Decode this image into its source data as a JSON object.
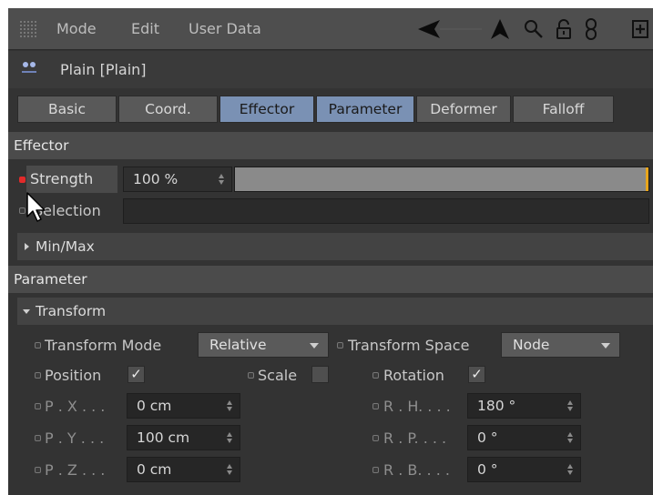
{
  "menu": {
    "items": [
      "Mode",
      "Edit",
      "User Data"
    ],
    "toolbar_icons": [
      "back-arrow-icon",
      "up-arrow-icon",
      "search-icon",
      "lock-icon",
      "link-icon",
      "new-panel-icon"
    ]
  },
  "object": {
    "icon": "null-object-icon",
    "name": "Plain [Plain]"
  },
  "tabs": [
    {
      "label": "Basic",
      "active": false
    },
    {
      "label": "Coord.",
      "active": false
    },
    {
      "label": "Effector",
      "active": true
    },
    {
      "label": "Parameter",
      "active": true
    },
    {
      "label": "Deformer",
      "active": false
    },
    {
      "label": "Falloff",
      "active": false
    }
  ],
  "effector": {
    "header": "Effector",
    "strength_label": "Strength",
    "strength_value": "100 %",
    "strength_fraction": 1.0,
    "selection_label": "Selection",
    "selection_value": "",
    "minmax_label": "Min/Max"
  },
  "parameter": {
    "header": "Parameter",
    "transform_label": "Transform",
    "transform_mode_label": "Transform Mode",
    "transform_mode_value": "Relative",
    "transform_space_label": "Transform Space",
    "transform_space_value": "Node",
    "position_label": "Position",
    "position_checked": true,
    "scale_label": "Scale",
    "scale_checked": false,
    "rotation_label": "Rotation",
    "rotation_checked": true,
    "check_mark": "✓",
    "px_label": "P . X . . .",
    "px_value": "0 cm",
    "py_label": "P . Y . . .",
    "py_value": "100 cm",
    "pz_label": "P . Z . . .",
    "pz_value": "0 cm",
    "rh_label": "R . H. . . .",
    "rh_value": "180 °",
    "rp_label": "R . P. . . .",
    "rp_value": "0 °",
    "rb_label": "R . B. . . .",
    "rb_value": "0 °"
  },
  "colors": {
    "active_tab": "#7a91b4",
    "keyframe_red": "#e22a2a",
    "slider_marker": "#e8a51c"
  }
}
